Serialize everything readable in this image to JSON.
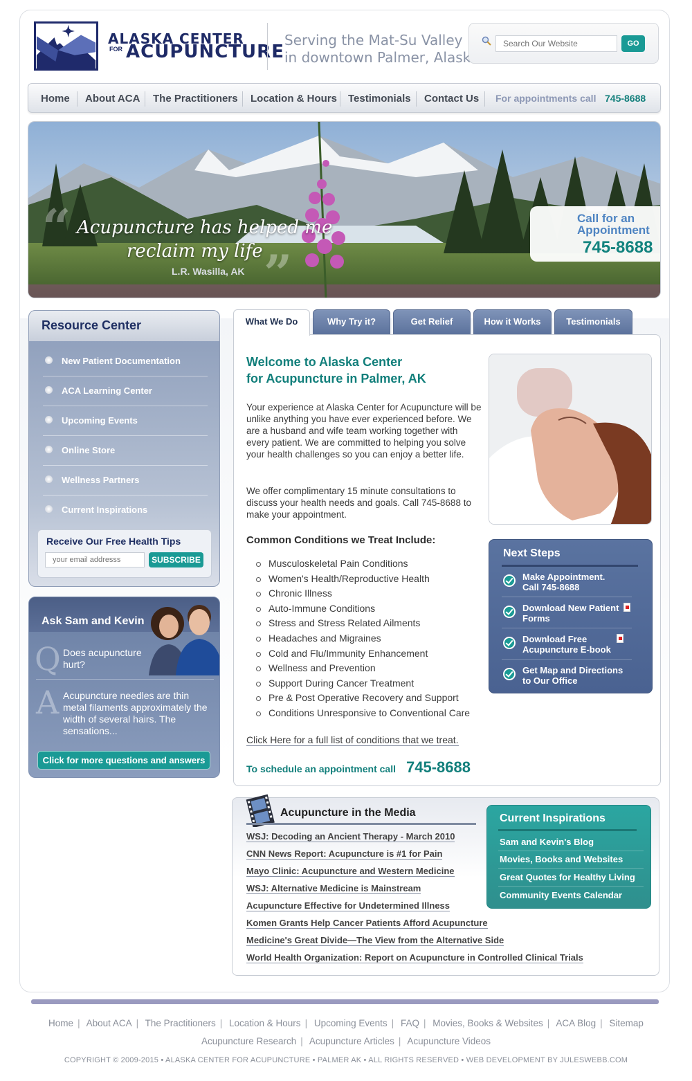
{
  "brand": {
    "line1": "ALASKA CENTER",
    "for": "FOR",
    "line2": "ACUPUNCTURE",
    "tagline1": "Serving the Mat-Su Valley",
    "tagline2": "in downtown Palmer, Alaska"
  },
  "search": {
    "placeholder": "Search Our Website",
    "button": "GO"
  },
  "nav": {
    "items": [
      "Home",
      "About ACA",
      "The Practitioners",
      "Location & Hours",
      "Testimonials",
      "Contact Us"
    ],
    "call_label": "For appointments call",
    "call_number": "745-8688"
  },
  "hero": {
    "quote_line1": "Acupuncture has helped me",
    "quote_line2": "reclaim my life",
    "author": "L.R. Wasilla, AK",
    "call_line1": "Call for an",
    "call_line2": "Appointment",
    "call_number": "745-8688"
  },
  "resource_center": {
    "title": "Resource Center",
    "items": [
      "New Patient Documentation",
      "ACA Learning Center",
      "Upcoming Events",
      "Online Store",
      "Wellness Partners",
      "Current Inspirations"
    ],
    "tips_title": "Receive Our Free Health Tips",
    "email_placeholder": "your email addresss",
    "subscribe": "SUBSCRIBE"
  },
  "ask": {
    "title": "Ask Sam and Kevin",
    "q_letter": "Q",
    "question": "Does acupuncture hurt?",
    "a_letter": "A",
    "answer": "Acupuncture needles are thin metal filaments approximately the width of several hairs. The sensations...",
    "button": "Click for more questions and answers"
  },
  "tabs": [
    "What We Do",
    "Why Try it?",
    "Get Relief",
    "How it Works",
    "Testimonials"
  ],
  "main": {
    "welcome_line1": "Welcome to Alaska Center",
    "welcome_line2": "for Acupuncture in Palmer, AK",
    "para1": "Your experience at Alaska Center for Acupuncture will be unlike anything you have ever experienced before. We are a husband and wife team working together with every patient. We are committed to helping you solve your health challenges so you can enjoy a better life.",
    "para2": "We offer complimentary 15 minute consultations to discuss your health needs and goals. Call 745-8688 to make your appointment.",
    "conditions_title": "Common Conditions we Treat Include:",
    "conditions": [
      "Musculoskeletal Pain Conditions",
      "Women's Health/Reproductive Health",
      "Chronic Illness",
      "Auto-Immune Conditions",
      "Stress and Stress Related Ailments",
      "Headaches and Migraines",
      "Cold and Flu/Immunity Enhancement",
      "Wellness and Prevention",
      "Support During Cancer Treatment",
      "Pre & Post Operative Recovery and Support",
      "Conditions Unresponsive to Conventional Care"
    ],
    "full_list_link": "Click Here for a full list of conditions that we treat.",
    "schedule_label": "To schedule an appointment call",
    "schedule_number": "745-8688"
  },
  "next_steps": {
    "title": "Next Steps",
    "items": [
      {
        "line1": "Make Appointment.",
        "line2": "Call 745-8688"
      },
      {
        "line1": "Download New Patient",
        "line2": "Forms"
      },
      {
        "line1": "Download Free",
        "line2": "Acupuncture E-book"
      },
      {
        "line1": "Get Map and Directions",
        "line2": "to Our Office"
      }
    ]
  },
  "media": {
    "title": "Acupuncture in the Media",
    "links": [
      "WSJ: Decoding an Ancient Therapy - March 2010",
      "CNN News Report: Acupuncture is #1 for Pain",
      "Mayo Clinic: Acupuncture and Western Medicine",
      "WSJ: Alternative Medicine is Mainstream",
      "Acupuncture Effective for Undetermined Illness",
      "Komen Grants Help Cancer Patients Afford Acupuncture",
      "Medicine's Great Divide—The View from the Alternative Side",
      "World Health Organization: Report on Acupuncture in Controlled Clinical Trials"
    ]
  },
  "inspirations": {
    "title": "Current Inspirations",
    "items": [
      "Sam and Kevin's Blog",
      "Movies, Books and Websites",
      "Great Quotes for Healthy Living",
      "Community Events Calendar"
    ]
  },
  "footer": {
    "row1": [
      "Home",
      "About ACA",
      "The Practitioners",
      "Location & Hours",
      "Upcoming Events",
      "FAQ",
      "Movies, Books & Websites",
      "ACA Blog",
      "Sitemap"
    ],
    "row2": [
      "Acupuncture Research",
      "Acupuncture Articles",
      "Acupuncture Videos"
    ],
    "copyright": "COPYRIGHT © 2009-2015 • ALASKA CENTER FOR ACUPUNCTURE • PALMER AK • ALL RIGHTS RESERVED • WEB DEVELOPMENT BY JULESWEBB.COM"
  },
  "colors": {
    "teal": "#127f7b",
    "navy": "#1e2a66",
    "slate": "#5c729c"
  }
}
